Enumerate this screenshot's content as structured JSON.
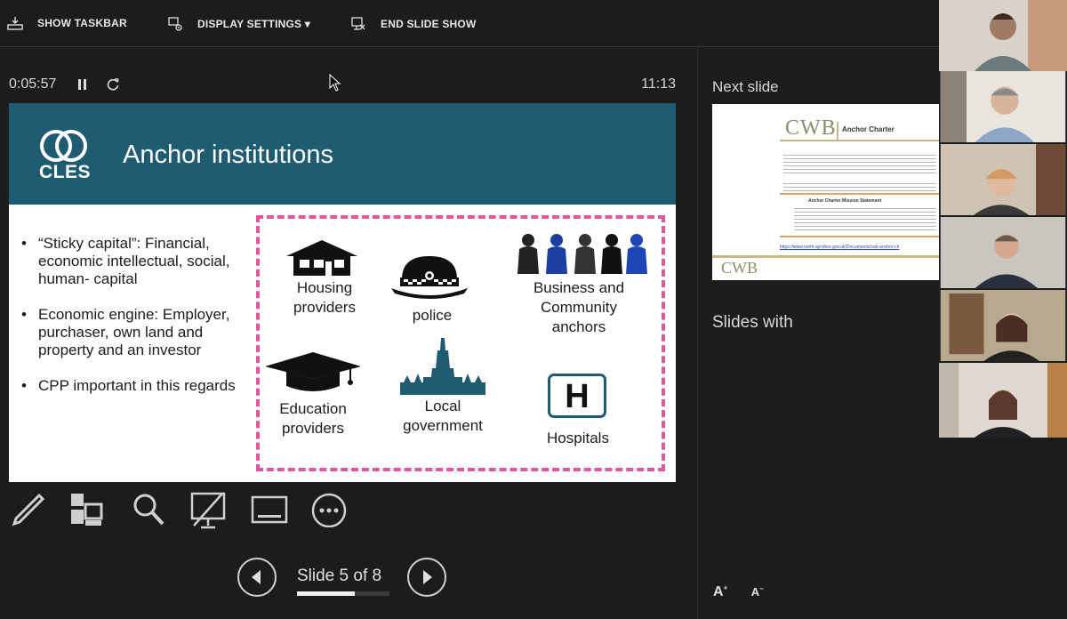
{
  "toolbar": {
    "show_taskbar": "SHOW TASKBAR",
    "display_settings": "DISPLAY SETTINGS ▾",
    "end_slide_show": "END SLIDE SHOW"
  },
  "timer": {
    "elapsed": "0:05:57",
    "clock": "11:13"
  },
  "slide": {
    "logo_text": "CLES",
    "title": "Anchor institutions",
    "bullets": [
      "“Sticky capital”: Financial, economic intellectual, social, human- capital",
      "Economic engine: Employer, purchaser, own land and property and an investor",
      "CPP important in this regards"
    ],
    "labels": {
      "housing": "Housing providers",
      "police": "police",
      "business": "Business and Community anchors",
      "education": "Education providers",
      "local": "Local government",
      "hospitals": "Hospitals"
    },
    "hospital_glyph": "H"
  },
  "navigation": {
    "slide_counter": "Slide 5 of 8",
    "progress": 0.625
  },
  "sidepanel": {
    "next_slide_label": "Next slide",
    "slides_with_label": "Slides with",
    "font_increase": "A",
    "font_decrease": "A"
  },
  "next_thumb": {
    "logo": "CWB",
    "title": "Anchor Charter",
    "mission": "Anchor Charter Mission Statement",
    "link": "https://www.north-ayrshire.gov.uk/Documents/cwb-anchor-ch"
  },
  "colors": {
    "accent_pink": "#e0579a",
    "slide_header": "#1f5c72",
    "hospital_border": "#1f5c72"
  }
}
